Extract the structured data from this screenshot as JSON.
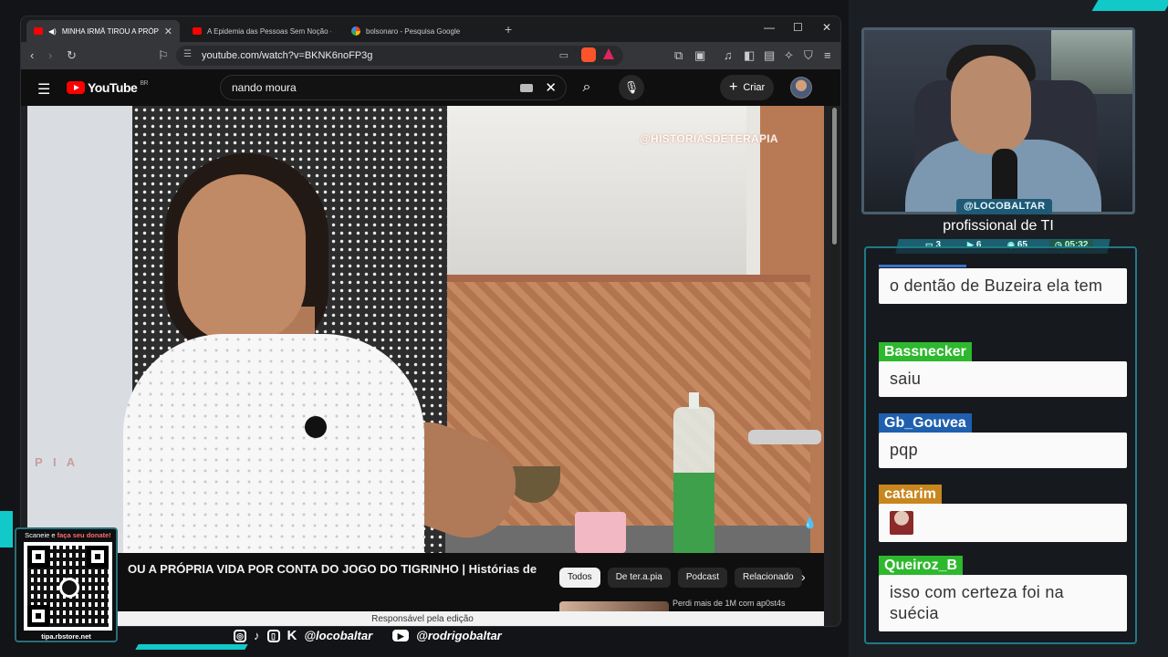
{
  "browser": {
    "tabs": [
      {
        "title": "MINHA IRMÃ TIROU A PRÓPRIA VIDA POR CONTA DO JOGO DO TIGRINHO",
        "active": true
      },
      {
        "title": "A Epidemia das Pessoas Sem Noção - YouTube",
        "active": false
      },
      {
        "title": "bolsonaro - Pesquisa Google",
        "active": false
      }
    ],
    "new_tab": "+",
    "url": "youtube.com/watch?v=BKNK6noFP3g"
  },
  "youtube": {
    "logo_text": "YouTube",
    "logo_region": "BR",
    "search_value": "nando moura",
    "create_label": "Criar",
    "video_watermark": "@HISTORIASDETERAPIA",
    "video_pia_mark": "P I A",
    "video_title": "OU A PRÓPRIA VIDA POR CONTA DO JOGO DO TIGRINHO | Histórias de",
    "chips": [
      "Todos",
      "De ter.a.pia",
      "Podcast",
      "Relacionado"
    ],
    "related_snippet": "Perdi mais de 1M com ap0st4s",
    "editing_label": "Responsável pela edição"
  },
  "stream": {
    "handle": "@LOCOBALTAR",
    "caption": "profissional de TI",
    "stats": {
      "chat": "3",
      "video": "6",
      "viewers": "65",
      "timer": "05:32"
    },
    "socials": {
      "handle1": "@locobaltar",
      "handle2": "@rodrigobaltar"
    },
    "qr_top_prefix": "Scaneie e ",
    "qr_top_highlight": "faça seu donate!",
    "qr_bottom": "tipa.rbstore.net"
  },
  "chat": {
    "messages": [
      {
        "user": "",
        "text": "o dentão de Buzeira ela tem",
        "color": "#3a73c7"
      },
      {
        "user": "Bassnecker",
        "text": "saiu",
        "color": "#2eb82e"
      },
      {
        "user": "Gb_Gouvea",
        "text": "pqp",
        "color": "#1f5fae"
      },
      {
        "user": "catarim",
        "text": "",
        "color": "#c8861e",
        "emote": true
      },
      {
        "user": "Queiroz_B",
        "text": "isso com certeza foi na suécia",
        "color": "#2eb82e"
      }
    ]
  },
  "colors": {
    "accent_teal": "#12c9c9",
    "youtube_red": "#ff0000",
    "chat_border": "#1f7a88"
  },
  "icons": {
    "nav": [
      "back-icon",
      "forward-icon",
      "reload-icon",
      "bookmark-icon"
    ],
    "toolbar_right": [
      "extensions-icon",
      "screenshot-icon",
      "music-icon",
      "sidebar-icon",
      "wallet-icon",
      "leo-icon",
      "shield-icon",
      "menu-icon"
    ]
  }
}
